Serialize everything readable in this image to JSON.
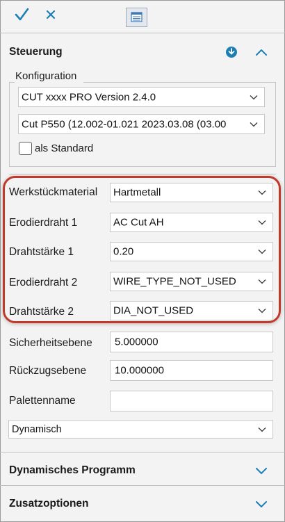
{
  "toolbar": {
    "confirm_icon": "check-icon",
    "cancel_icon": "close-icon",
    "form_icon": "form-icon"
  },
  "steuerung": {
    "title": "Steuerung",
    "konfiguration": {
      "legend": "Konfiguration",
      "version_select": "CUT xxxx PRO Version 2.4.0",
      "machine_select": "Cut P550 (12.002-01.021 2023.03.08 (03.00",
      "als_standard_label": "als Standard",
      "als_standard_checked": false
    }
  },
  "fields": [
    {
      "label": "Werkstückmaterial",
      "value": "Hartmetall"
    },
    {
      "label": "Erodierdraht 1",
      "value": "AC Cut AH"
    },
    {
      "label": "Drahtstärke 1",
      "value": "0.20"
    },
    {
      "label": "Erodierdraht 2",
      "value": "WIRE_TYPE_NOT_USED"
    },
    {
      "label": "Drahtstärke 2",
      "value": "DIA_NOT_USED"
    }
  ],
  "inputs": [
    {
      "label": "Sicherheitsebene",
      "value": "5.000000"
    },
    {
      "label": "Rückzugsebene",
      "value": "10.000000"
    },
    {
      "label": "Palettenname",
      "value": ""
    }
  ],
  "mode_select": "Dynamisch",
  "sections": {
    "dynamisches_programm": "Dynamisches Programm",
    "zusatzoptionen": "Zusatzoptionen"
  },
  "colors": {
    "accent": "#1b7fb5",
    "highlight": "#c0392b"
  }
}
